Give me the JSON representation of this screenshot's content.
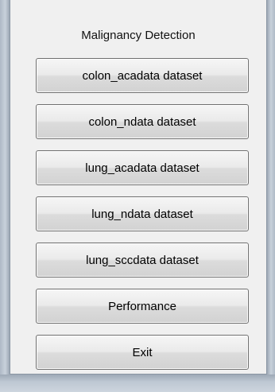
{
  "panel": {
    "title": "Malignancy Detection"
  },
  "buttons": [
    {
      "label": "colon_acadata dataset"
    },
    {
      "label": "colon_ndata dataset"
    },
    {
      "label": "lung_acadata dataset"
    },
    {
      "label": "lung_ndata dataset"
    },
    {
      "label": "lung_sccdata dataset"
    },
    {
      "label": "Performance"
    },
    {
      "label": "Exit"
    }
  ],
  "colors": {
    "panel_background": "#f0f0f0",
    "window_frame": "#b9c3cf",
    "button_border": "#707070"
  }
}
